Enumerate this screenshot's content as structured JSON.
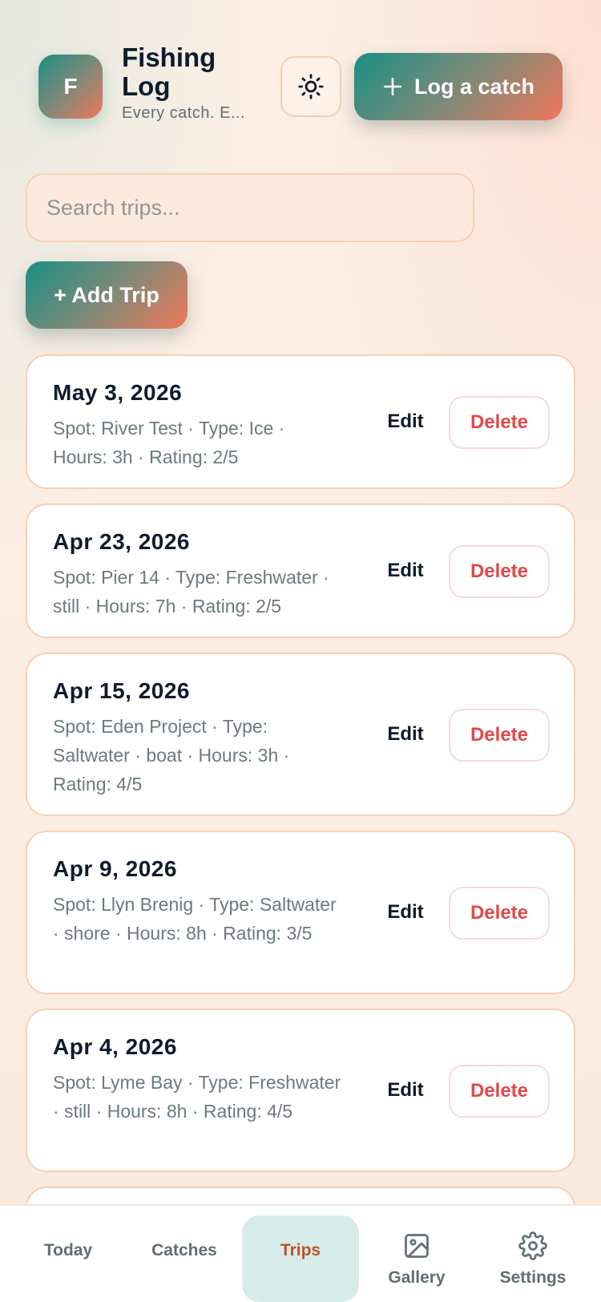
{
  "header": {
    "avatar_letter": "F",
    "title": "Fishing Log",
    "subtitle": "Every catch. E...",
    "theme_icon": "sun-icon",
    "log_button_label": "Log a catch",
    "log_button_icon": "plus-icon"
  },
  "search": {
    "placeholder": "Search trips...",
    "value": ""
  },
  "add_trip_label": "+ Add Trip",
  "trips": [
    {
      "date": "May 3, 2026",
      "meta": "Spot: River Test · Type: Ice · Hours: 3h · Rating: 2/5",
      "edit_label": "Edit",
      "delete_label": "Delete"
    },
    {
      "date": "Apr 23, 2026",
      "meta": "Spot: Pier 14 · Type: Freshwater · still · Hours: 7h · Rating: 2/5",
      "edit_label": "Edit",
      "delete_label": "Delete"
    },
    {
      "date": "Apr 15, 2026",
      "meta": "Spot: Eden Project · Type: Saltwater · boat · Hours: 3h · Rating: 4/5",
      "edit_label": "Edit",
      "delete_label": "Delete"
    },
    {
      "date": "Apr 9, 2026",
      "meta": "Spot: Llyn Brenig · Type: Saltwater · shore · Hours: 8h · Rating: 3/5",
      "edit_label": "Edit",
      "delete_label": "Delete"
    },
    {
      "date": "Apr 4, 2026",
      "meta": "Spot: Lyme Bay · Type: Freshwater · still · Hours: 8h · Rating: 4/5",
      "edit_label": "Edit",
      "delete_label": "Delete"
    }
  ],
  "nav": {
    "today": "Today",
    "catches": "Catches",
    "trips": "Trips",
    "gallery": "Gallery",
    "settings": "Settings",
    "active": "trips"
  },
  "colors": {
    "accent_teal": "#1a8f86",
    "accent_coral": "#f0775a",
    "delete_red": "#e3474a",
    "active_tab_bg": "#d5ece9",
    "active_tab_text": "#c2502d"
  }
}
